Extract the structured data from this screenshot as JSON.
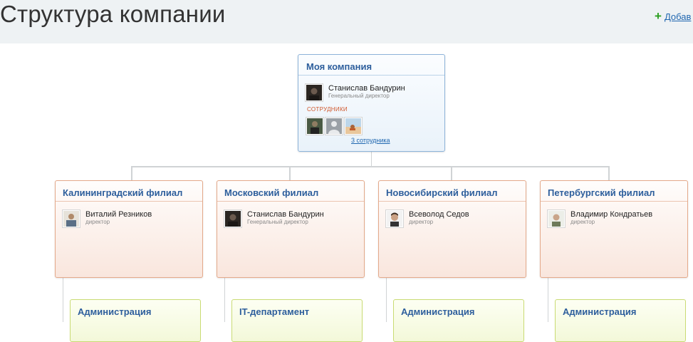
{
  "page": {
    "title": "Структура компании",
    "add_label": "Добав"
  },
  "root": {
    "title": "Моя компания",
    "head": {
      "name": "Станислав Бандурин",
      "position": "Генеральный директор"
    },
    "staff_label": "СОТРУДНИКИ",
    "staff_link": "3 сотрудника"
  },
  "branches": [
    {
      "title": "Калининградский филиал",
      "head": {
        "name": "Виталий Резников",
        "position": "директор"
      }
    },
    {
      "title": "Московский филиал",
      "head": {
        "name": "Станислав Бандурин",
        "position": "Генеральный директор"
      }
    },
    {
      "title": "Новосибирский филиал",
      "head": {
        "name": "Всеволод Седов",
        "position": "директор"
      }
    },
    {
      "title": "Петербургский филиал",
      "head": {
        "name": "Владимир Кондратьев",
        "position": "директор"
      }
    }
  ],
  "departments": [
    {
      "title": "Администрация"
    },
    {
      "title": "IT-департамент"
    },
    {
      "title": "Администрация"
    },
    {
      "title": "Администрация"
    }
  ],
  "colors": {
    "root_border": "#8db3d9",
    "branch_border": "#e4a98a",
    "dept_border": "#c9db73",
    "title_link": "#2d5e9c",
    "accent_orange": "#d0562a",
    "add_plus": "#2a9e1f"
  }
}
